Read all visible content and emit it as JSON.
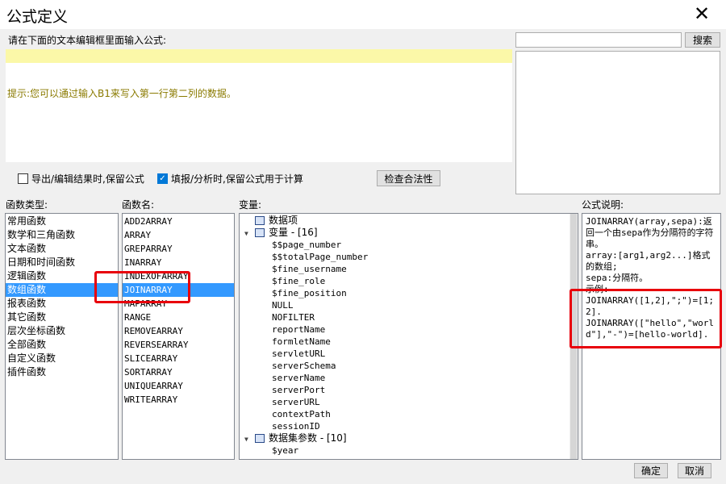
{
  "window": {
    "title": "公式定义",
    "close_label": "✕"
  },
  "editor": {
    "label": "请在下面的文本编辑框里面输入公式:",
    "hint": "提示:您可以通过输入B1来写入第一行第二列的数据。"
  },
  "search": {
    "value": "",
    "button_label": "搜索"
  },
  "options": {
    "export_label": "导出/编辑结果时,保留公式",
    "export_checked": false,
    "fill_label": "填报/分析时,保留公式用于计算",
    "fill_checked": true,
    "check_label": "检查合法性"
  },
  "categories": {
    "label": "函数类型:",
    "items": [
      "常用函数",
      "数学和三角函数",
      "文本函数",
      "日期和时间函数",
      "逻辑函数",
      "数组函数",
      "报表函数",
      "其它函数",
      "层次坐标函数",
      "全部函数",
      "自定义函数",
      "插件函数"
    ],
    "selected": "数组函数"
  },
  "functions": {
    "label": "函数名:",
    "items": [
      "ADD2ARRAY",
      "ARRAY",
      "GREPARRAY",
      "INARRAY",
      "INDEXOFARRAY",
      "JOINARRAY",
      "MAPARRAY",
      "RANGE",
      "REMOVEARRAY",
      "REVERSEARRAY",
      "SLICEARRAY",
      "SORTARRAY",
      "UNIQUEARRAY",
      "WRITEARRAY"
    ],
    "selected": "JOINARRAY"
  },
  "variables": {
    "label": "变量:",
    "data_item": "数据项",
    "var_group": "变量 - [16]",
    "var_items": [
      "$$page_number",
      "$$totalPage_number",
      "$fine_username",
      "$fine_role",
      "$fine_position",
      "NULL",
      "NOFILTER",
      "reportName",
      "formletName",
      "servletURL",
      "serverSchema",
      "serverName",
      "serverPort",
      "serverURL",
      "contextPath",
      "sessionID"
    ],
    "dataset_group": "数据集参数 - [10]",
    "dataset_items": [
      "$year"
    ]
  },
  "description": {
    "label": "公式说明:",
    "text": "JOINARRAY(array,sepa):返回一个由sepa作为分隔符的字符串。\narray:[arg1,arg2...]格式的数组;\nsepa:分隔符。\n示例:\nJOINARRAY([1,2],\";\")=[1;2].\nJOINARRAY([\"hello\",\"world\"],\"-\")=[hello-world]."
  },
  "footer": {
    "ok_label": "确定",
    "cancel_label": "取消"
  },
  "colors": {
    "selection": "#3399ff",
    "highlight_line": "#fbf8a8",
    "hint_text": "#8a7a00",
    "annotation": "#e8000b"
  }
}
